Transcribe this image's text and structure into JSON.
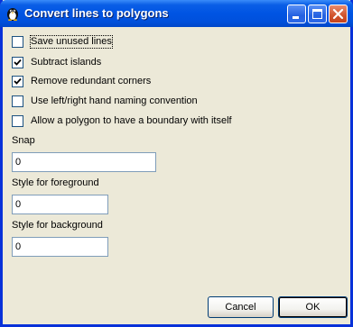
{
  "window": {
    "title": "Convert lines to polygons",
    "app_icon": "penguin-icon",
    "controls": [
      "minimize-icon",
      "maximize-icon",
      "close-icon"
    ]
  },
  "options": [
    {
      "label": "Save unused lines",
      "checked": false
    },
    {
      "label": "Subtract islands",
      "checked": true
    },
    {
      "label": "Remove redundant corners",
      "checked": true
    },
    {
      "label": "Use left/right hand naming convention",
      "checked": false
    },
    {
      "label": "Allow a polygon to have a boundary with itself",
      "checked": false
    }
  ],
  "snap": {
    "label": "Snap",
    "value": "0"
  },
  "foreground": {
    "label": "Style for foreground",
    "value": "0"
  },
  "background": {
    "label": "Style for background",
    "value": "0"
  },
  "buttons": {
    "cancel": "Cancel",
    "ok": "OK"
  },
  "colors": {
    "titlebar": "#0054e3",
    "dialog_bg": "#ece9d8",
    "field_border": "#7f9db9"
  }
}
